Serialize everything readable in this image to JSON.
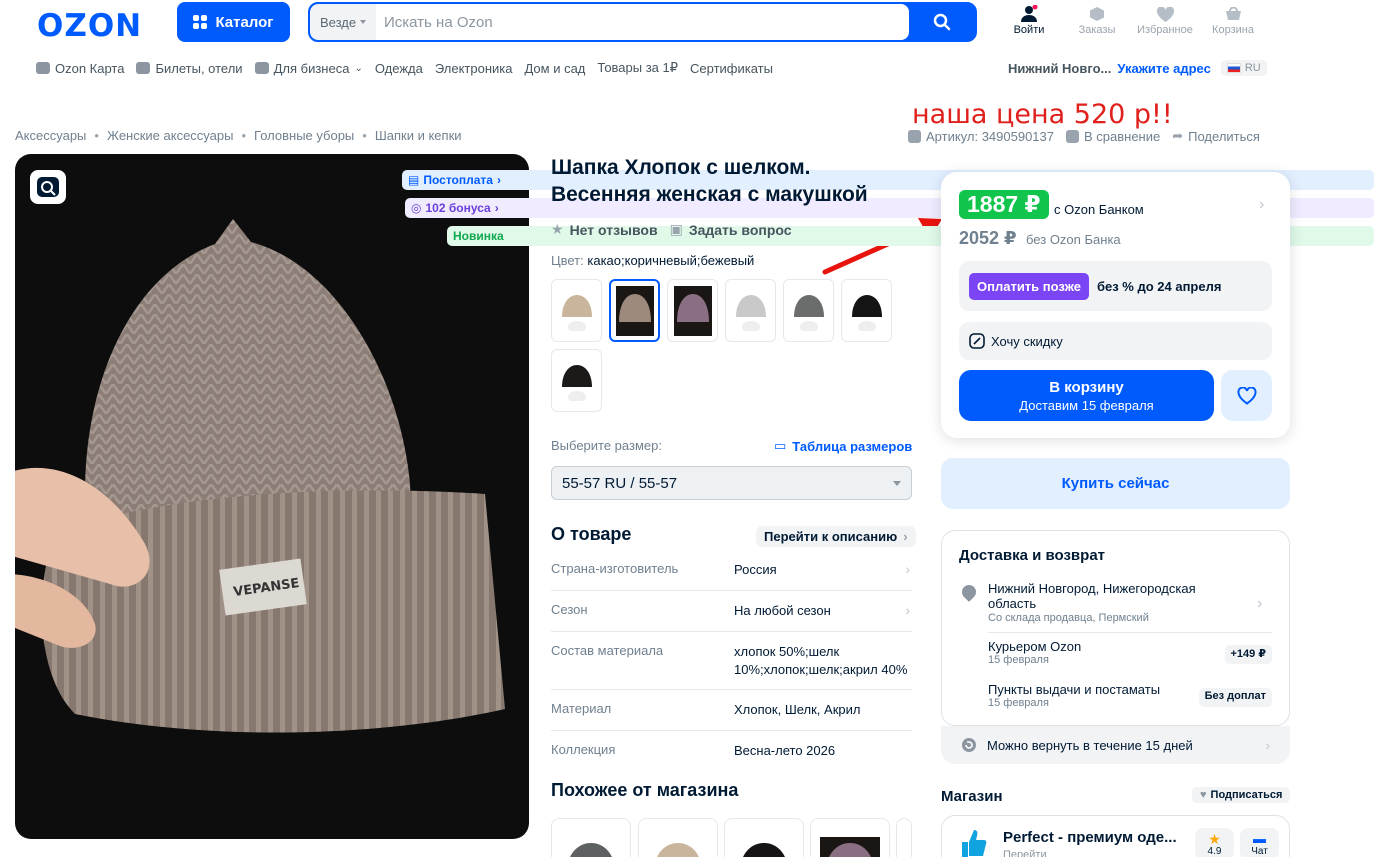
{
  "header": {
    "logo": "OZON",
    "catalog_label": "Каталог",
    "search_scope": "Везде",
    "search_placeholder": "Искать на Ozon",
    "icons": [
      {
        "label": "Войти",
        "icon": "user-icon"
      },
      {
        "label": "Заказы",
        "icon": "box-icon"
      },
      {
        "label": "Избранное",
        "icon": "heart-icon"
      },
      {
        "label": "Корзина",
        "icon": "cart-icon"
      }
    ]
  },
  "nav": {
    "items": [
      "Ozon Карта",
      "Билеты, отели",
      "Для бизнеса",
      "Одежда",
      "Электроника",
      "Дом и сад",
      "Товары за 1₽",
      "Сертификаты"
    ],
    "city": "Нижний Новго...",
    "address_link": "Укажите адрес",
    "lang": "RU"
  },
  "breadcrumbs": [
    "Аксессуары",
    "Женские аксессуары",
    "Головные уборы",
    "Шапки и кепки"
  ],
  "annotation": "наша цена 520 р!!",
  "meta": {
    "article": "Артикул: 3490590137",
    "compare": "В сравнение",
    "share": "Поделиться"
  },
  "badges": {
    "postpay": "Постоплата",
    "bonus": "102 бонуса",
    "new": "Новинка"
  },
  "product": {
    "title": "Шапка Хлопок с шелком. Весенняя женская с макушкой",
    "reviews": "Нет отзывов",
    "ask": "Задать вопрос",
    "color_label": "Цвет:",
    "color_value": "какао;коричневый;бежевый",
    "size_label": "Выберите размер:",
    "size_table": "Таблица размеров",
    "size_value": "55-57 RU / 55-57",
    "about_title": "О товаре",
    "to_description": "Перейти к описанию",
    "specs": [
      {
        "key": "Страна-изготовитель",
        "value": "Россия"
      },
      {
        "key": "Сезон",
        "value": "На любой сезон"
      },
      {
        "key": "Состав материала",
        "value": "хлопок 50%;шелк 10%;хлопок;шелк;акрил 40%"
      },
      {
        "key": "Материал",
        "value": "Хлопок, Шелк, Акрил"
      },
      {
        "key": "Коллекция",
        "value": "Весна-лето 2026"
      }
    ],
    "similar_title": "Похожее от магазина"
  },
  "colors": {
    "accent": "#005bff",
    "green": "#10c44c",
    "paylater": "#7b45f5",
    "annotation": "#e0201c"
  },
  "price": {
    "card_price": "1887 ₽",
    "card_label": "с Ozon Банком",
    "regular_price": "2052 ₽",
    "regular_label": "без Ozon Банка",
    "paylater_btn": "Оплатить позже",
    "paylater_text": "без % до 24 апреля",
    "discount": "Хочу скидку",
    "cart_label": "В корзину",
    "cart_sub": "Доставим 15 февраля",
    "buy_now": "Купить сейчас"
  },
  "delivery": {
    "title": "Доставка и возврат",
    "city": "Нижний Новгород, Нижегородская область",
    "city_sub": "Со склада продавца, Пермский",
    "options": [
      {
        "name": "Курьером Ozon",
        "date": "15 февраля",
        "price": "+149 ₽"
      },
      {
        "name": "Пункты выдачи и постаматы",
        "date": "15 февраля",
        "price": "Без доплат"
      }
    ],
    "return": "Можно вернуть в течение 15 дней"
  },
  "shop": {
    "title": "Магазин",
    "subscribe": "Подписаться",
    "name": "Perfect - премиум оде...",
    "sub": "Перейти",
    "rating": "4.9",
    "chat": "Чат"
  }
}
